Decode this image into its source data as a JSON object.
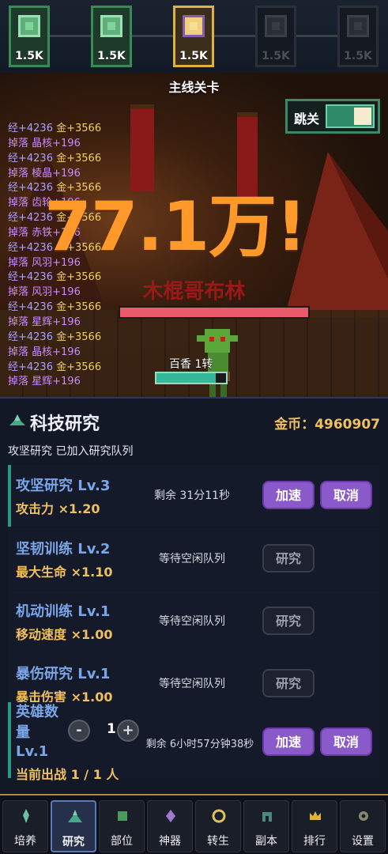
{
  "stages": [
    {
      "value": "1.5K",
      "state": "cleared"
    },
    {
      "value": "1.5K",
      "state": "cleared"
    },
    {
      "value": "1.5K",
      "state": "current"
    },
    {
      "value": "1.5K",
      "state": "locked"
    },
    {
      "value": "1.5K",
      "state": "locked"
    }
  ],
  "battle": {
    "title": "主线关卡",
    "skip_label": "跳关",
    "skip_on": true,
    "damage": "77.1万!",
    "enemy_name": "木棍哥布林",
    "enemy_hp_fraction": 1.0,
    "hero_name": "百香 1转",
    "hero_hp_fraction": 0.85
  },
  "log": [
    {
      "type": "reward",
      "exp": "经+4236",
      "gold": "金+3566"
    },
    {
      "type": "drop",
      "text": "掉落 晶核+196"
    },
    {
      "type": "reward",
      "exp": "经+4236",
      "gold": "金+3566"
    },
    {
      "type": "drop",
      "text": "掉落 棱晶+196"
    },
    {
      "type": "reward",
      "exp": "经+4236",
      "gold": "金+3566"
    },
    {
      "type": "drop",
      "text": "掉落 齿轮+196"
    },
    {
      "type": "reward",
      "exp": "经+4236",
      "gold": "金+3566"
    },
    {
      "type": "drop",
      "text": "掉落 赤铁+196"
    },
    {
      "type": "reward",
      "exp": "经+4236",
      "gold": "金+3566"
    },
    {
      "type": "drop",
      "text": "掉落 风羽+196"
    },
    {
      "type": "reward",
      "exp": "经+4236",
      "gold": "金+3566"
    },
    {
      "type": "drop",
      "text": "掉落 风羽+196"
    },
    {
      "type": "reward",
      "exp": "经+4236",
      "gold": "金+3566"
    },
    {
      "type": "drop",
      "text": "掉落 星辉+196"
    },
    {
      "type": "reward",
      "exp": "经+4236",
      "gold": "金+3566"
    },
    {
      "type": "drop",
      "text": "掉落 晶核+196"
    },
    {
      "type": "reward",
      "exp": "经+4236",
      "gold": "金+3566"
    },
    {
      "type": "drop",
      "text": "掉落 星辉+196"
    }
  ],
  "research": {
    "title": "科技研究",
    "gold_label": "金币：",
    "gold_value": "4960907",
    "notice": "攻坚研究 已加入研究队列",
    "tasks": [
      {
        "name": "攻坚研究  Lv.3",
        "effect": "攻击力 ×1.20",
        "status": "剩余 31分11秒",
        "btn1": "加速",
        "btn2": "取消",
        "active": true
      },
      {
        "name": "坚韧训练  Lv.2",
        "effect": "最大生命 ×1.10",
        "status": "等待空闲队列",
        "btn1": "研究",
        "active": false
      },
      {
        "name": "机动训练  Lv.1",
        "effect": "移动速度 ×1.00",
        "status": "等待空闲队列",
        "btn1": "研究",
        "active": false
      },
      {
        "name": "暴伤研究  Lv.1",
        "effect": "暴击伤害 ×1.00",
        "status": "等待空闲队列",
        "btn1": "研究",
        "active": false
      }
    ],
    "hero_task": {
      "name_line1": "英雄数",
      "name_line2": "量",
      "name_line3": "Lv.1",
      "minus": "-",
      "plus": "+",
      "count": "1",
      "status": "剩余 6小时57分钟38秒",
      "btn1": "加速",
      "btn2": "取消",
      "footer": "当前出战 1 / 1 人"
    }
  },
  "nav": [
    {
      "label": "培养",
      "icon": "cultivate-icon"
    },
    {
      "label": "研究",
      "icon": "research-icon",
      "active": true
    },
    {
      "label": "部位",
      "icon": "equipment-icon"
    },
    {
      "label": "神器",
      "icon": "artifact-icon"
    },
    {
      "label": "转生",
      "icon": "rebirth-icon"
    },
    {
      "label": "副本",
      "icon": "dungeon-icon"
    },
    {
      "label": "排行",
      "icon": "ranking-icon"
    },
    {
      "label": "设置",
      "icon": "settings-icon"
    }
  ],
  "colors": {
    "accent_gold": "#f0c060",
    "purple_button": "#8a5acb",
    "task_name_blue": "#7aa6e8",
    "damage_orange": "#ff9a2a"
  }
}
